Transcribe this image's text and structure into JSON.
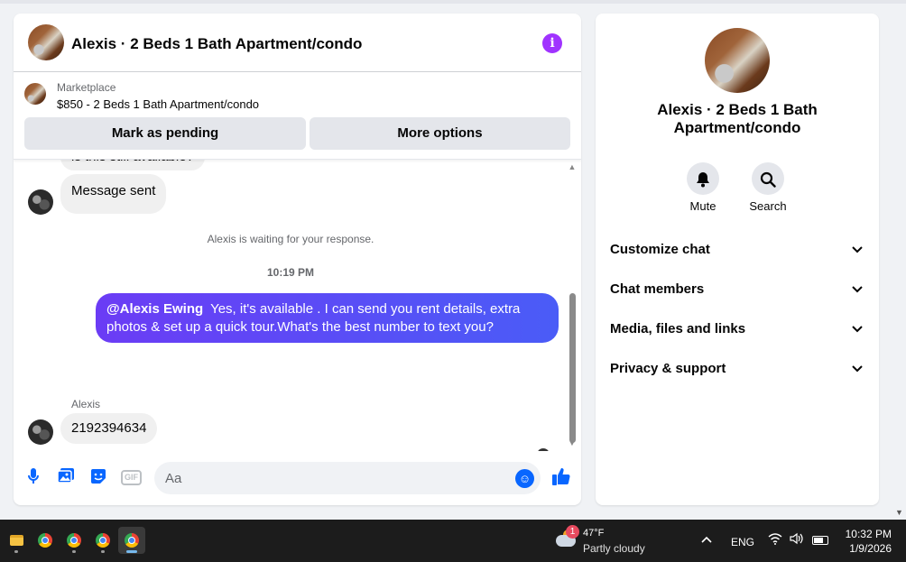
{
  "chat": {
    "title": "Alexis · 2 Beds 1 Bath Apartment/condo",
    "info_icon": "i",
    "marketplace": {
      "label": "Marketplace",
      "listing": "$850 - 2 Beds 1 Bath Apartment/condo",
      "pending_button": "Mark as pending",
      "more_button": "More options"
    },
    "messages": {
      "previous_partial": "is this still available?",
      "sent_notice": "Message sent",
      "waiting": "Alexis is waiting for your response.",
      "timestamp": "10:19 PM",
      "outgoing_mention": "@Alexis Ewing",
      "outgoing_text": "Yes, it's available .  I can send you rent details, extra photos & set up a quick tour.What's the best number to text you?",
      "sender_name": "Alexis",
      "incoming_text": "2192394634"
    },
    "composer": {
      "placeholder": "Aa",
      "gif_label": "GIF"
    }
  },
  "side": {
    "title": "Alexis · 2 Beds 1 Bath Apartment/condo",
    "actions": [
      {
        "label": "Mute",
        "icon": "bell-icon"
      },
      {
        "label": "Search",
        "icon": "search-icon"
      }
    ],
    "menu": [
      {
        "label": "Customize chat"
      },
      {
        "label": "Chat members"
      },
      {
        "label": "Media, files and links"
      },
      {
        "label": "Privacy & support"
      }
    ]
  },
  "taskbar": {
    "weather_badge": "1",
    "temperature": "47°F",
    "condition": "Partly cloudy",
    "language": "ENG",
    "time": "10:32 PM",
    "date": "1/9/2026"
  },
  "colors": {
    "accent": "#0866ff",
    "outgoing_bubble_start": "#6b3cf5",
    "outgoing_bubble_end": "#4a5cf7",
    "info_icon": "#a033ff"
  }
}
